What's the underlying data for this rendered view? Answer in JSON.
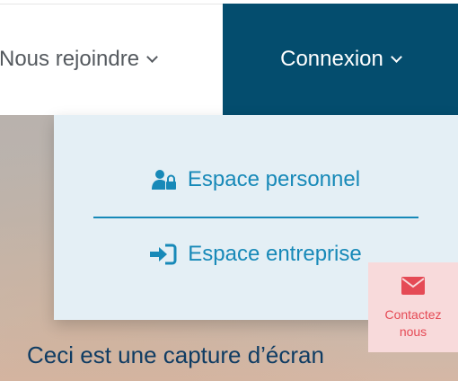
{
  "nav": {
    "join_label": "Nous rejoindre",
    "login_label": "Connexion"
  },
  "dropdown": {
    "items": [
      {
        "label": "Espace personnel",
        "icon": "user-lock-icon"
      },
      {
        "label": "Espace entreprise",
        "icon": "sign-in-icon"
      }
    ]
  },
  "contact": {
    "line1": "Contactez",
    "line2": "nous",
    "icon": "envelope-icon"
  },
  "hero": {
    "caption": "Ceci est une capture d’écran"
  },
  "colors": {
    "login_bg": "#044d6e",
    "dropdown_bg": "#e4eff5",
    "accent": "#1789b8",
    "contact_bg": "#f8dadb",
    "contact_fg": "#e54a55",
    "caption": "#0f3c63"
  }
}
